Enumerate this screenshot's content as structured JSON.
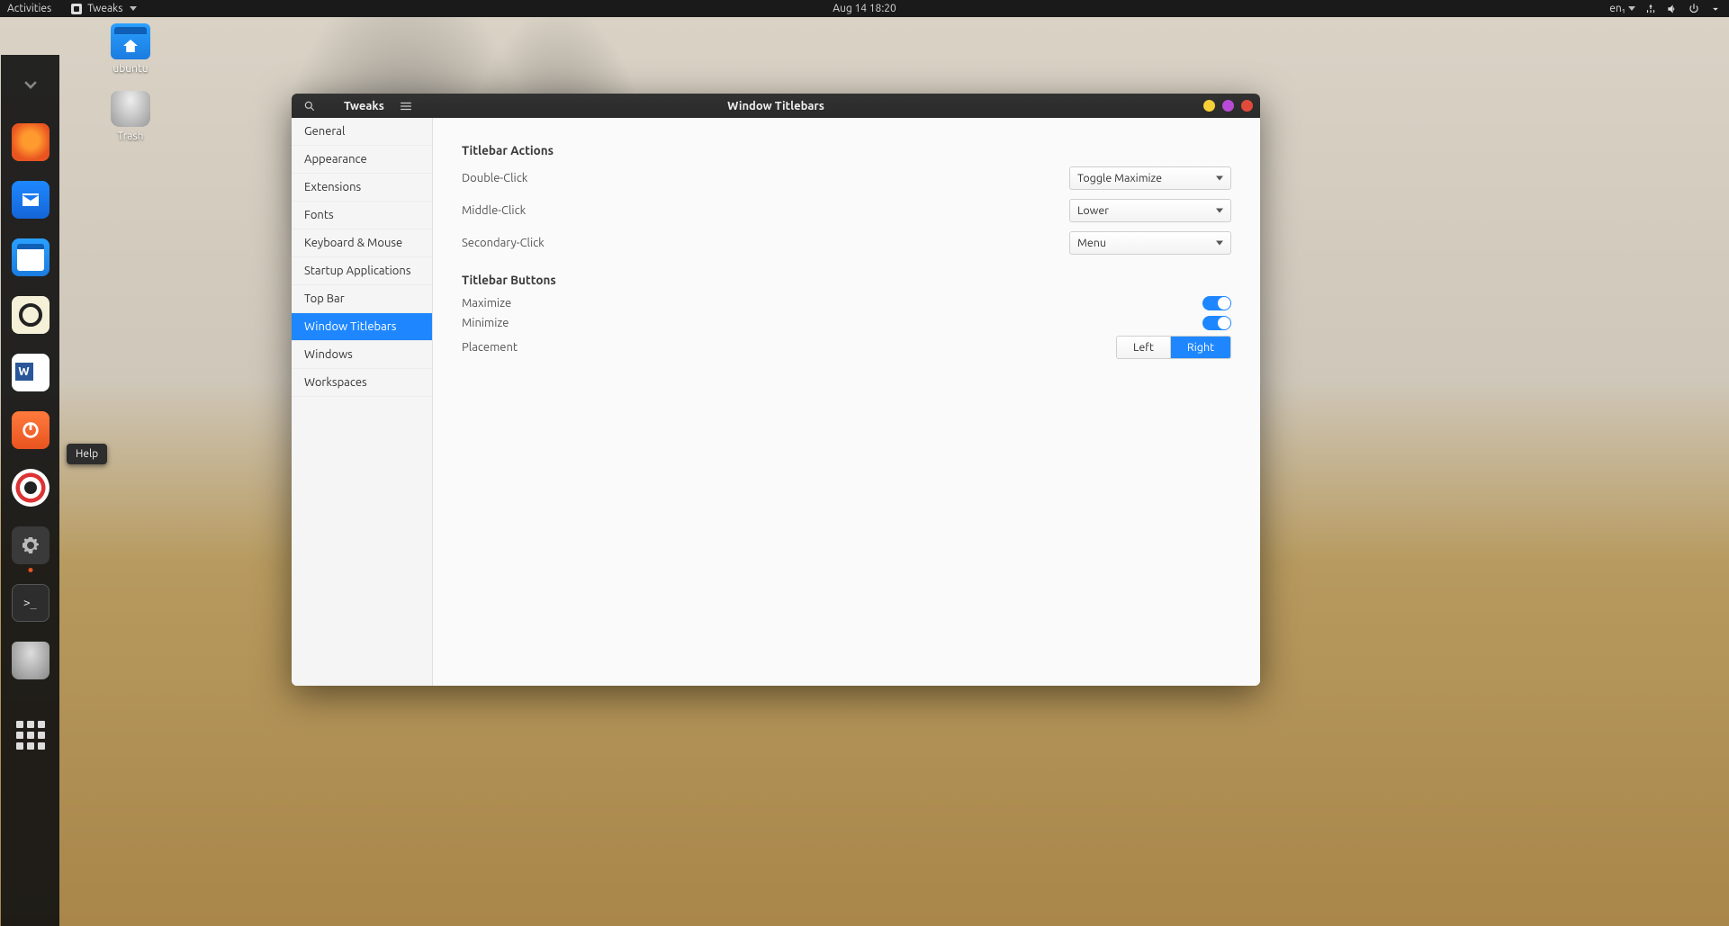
{
  "top_panel": {
    "activities": "Activities",
    "app_menu": "Tweaks",
    "datetime": "Aug 14  18:20",
    "lang": "en₁"
  },
  "desktop_icons": {
    "home": "ubuntu",
    "trash": "Trash"
  },
  "dock": {
    "tooltip": "Help"
  },
  "window": {
    "app_title": "Tweaks",
    "header_title": "Window Titlebars",
    "sidebar": [
      "General",
      "Appearance",
      "Extensions",
      "Fonts",
      "Keyboard & Mouse",
      "Startup Applications",
      "Top Bar",
      "Window Titlebars",
      "Windows",
      "Workspaces"
    ],
    "sidebar_selected_index": 7,
    "sections": {
      "actions": {
        "title": "Titlebar Actions",
        "double_click": {
          "label": "Double-Click",
          "value": "Toggle Maximize"
        },
        "middle_click": {
          "label": "Middle-Click",
          "value": "Lower"
        },
        "secondary_click": {
          "label": "Secondary-Click",
          "value": "Menu"
        }
      },
      "buttons": {
        "title": "Titlebar Buttons",
        "maximize": {
          "label": "Maximize",
          "enabled": true
        },
        "minimize": {
          "label": "Minimize",
          "enabled": true
        },
        "placement": {
          "label": "Placement",
          "options": [
            "Left",
            "Right"
          ],
          "selected": "Right"
        }
      }
    }
  }
}
